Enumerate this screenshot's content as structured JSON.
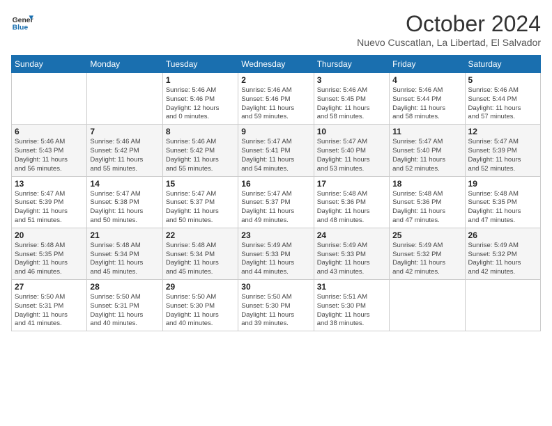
{
  "header": {
    "logo_general": "General",
    "logo_blue": "Blue",
    "month_title": "October 2024",
    "location": "Nuevo Cuscatlan, La Libertad, El Salvador"
  },
  "calendar": {
    "days_of_week": [
      "Sunday",
      "Monday",
      "Tuesday",
      "Wednesday",
      "Thursday",
      "Friday",
      "Saturday"
    ],
    "weeks": [
      [
        {
          "day": "",
          "info": ""
        },
        {
          "day": "",
          "info": ""
        },
        {
          "day": "1",
          "info": "Sunrise: 5:46 AM\nSunset: 5:46 PM\nDaylight: 12 hours\nand 0 minutes."
        },
        {
          "day": "2",
          "info": "Sunrise: 5:46 AM\nSunset: 5:46 PM\nDaylight: 11 hours\nand 59 minutes."
        },
        {
          "day": "3",
          "info": "Sunrise: 5:46 AM\nSunset: 5:45 PM\nDaylight: 11 hours\nand 58 minutes."
        },
        {
          "day": "4",
          "info": "Sunrise: 5:46 AM\nSunset: 5:44 PM\nDaylight: 11 hours\nand 58 minutes."
        },
        {
          "day": "5",
          "info": "Sunrise: 5:46 AM\nSunset: 5:44 PM\nDaylight: 11 hours\nand 57 minutes."
        }
      ],
      [
        {
          "day": "6",
          "info": "Sunrise: 5:46 AM\nSunset: 5:43 PM\nDaylight: 11 hours\nand 56 minutes."
        },
        {
          "day": "7",
          "info": "Sunrise: 5:46 AM\nSunset: 5:42 PM\nDaylight: 11 hours\nand 55 minutes."
        },
        {
          "day": "8",
          "info": "Sunrise: 5:46 AM\nSunset: 5:42 PM\nDaylight: 11 hours\nand 55 minutes."
        },
        {
          "day": "9",
          "info": "Sunrise: 5:47 AM\nSunset: 5:41 PM\nDaylight: 11 hours\nand 54 minutes."
        },
        {
          "day": "10",
          "info": "Sunrise: 5:47 AM\nSunset: 5:40 PM\nDaylight: 11 hours\nand 53 minutes."
        },
        {
          "day": "11",
          "info": "Sunrise: 5:47 AM\nSunset: 5:40 PM\nDaylight: 11 hours\nand 52 minutes."
        },
        {
          "day": "12",
          "info": "Sunrise: 5:47 AM\nSunset: 5:39 PM\nDaylight: 11 hours\nand 52 minutes."
        }
      ],
      [
        {
          "day": "13",
          "info": "Sunrise: 5:47 AM\nSunset: 5:39 PM\nDaylight: 11 hours\nand 51 minutes."
        },
        {
          "day": "14",
          "info": "Sunrise: 5:47 AM\nSunset: 5:38 PM\nDaylight: 11 hours\nand 50 minutes."
        },
        {
          "day": "15",
          "info": "Sunrise: 5:47 AM\nSunset: 5:37 PM\nDaylight: 11 hours\nand 50 minutes."
        },
        {
          "day": "16",
          "info": "Sunrise: 5:47 AM\nSunset: 5:37 PM\nDaylight: 11 hours\nand 49 minutes."
        },
        {
          "day": "17",
          "info": "Sunrise: 5:48 AM\nSunset: 5:36 PM\nDaylight: 11 hours\nand 48 minutes."
        },
        {
          "day": "18",
          "info": "Sunrise: 5:48 AM\nSunset: 5:36 PM\nDaylight: 11 hours\nand 47 minutes."
        },
        {
          "day": "19",
          "info": "Sunrise: 5:48 AM\nSunset: 5:35 PM\nDaylight: 11 hours\nand 47 minutes."
        }
      ],
      [
        {
          "day": "20",
          "info": "Sunrise: 5:48 AM\nSunset: 5:35 PM\nDaylight: 11 hours\nand 46 minutes."
        },
        {
          "day": "21",
          "info": "Sunrise: 5:48 AM\nSunset: 5:34 PM\nDaylight: 11 hours\nand 45 minutes."
        },
        {
          "day": "22",
          "info": "Sunrise: 5:48 AM\nSunset: 5:34 PM\nDaylight: 11 hours\nand 45 minutes."
        },
        {
          "day": "23",
          "info": "Sunrise: 5:49 AM\nSunset: 5:33 PM\nDaylight: 11 hours\nand 44 minutes."
        },
        {
          "day": "24",
          "info": "Sunrise: 5:49 AM\nSunset: 5:33 PM\nDaylight: 11 hours\nand 43 minutes."
        },
        {
          "day": "25",
          "info": "Sunrise: 5:49 AM\nSunset: 5:32 PM\nDaylight: 11 hours\nand 42 minutes."
        },
        {
          "day": "26",
          "info": "Sunrise: 5:49 AM\nSunset: 5:32 PM\nDaylight: 11 hours\nand 42 minutes."
        }
      ],
      [
        {
          "day": "27",
          "info": "Sunrise: 5:50 AM\nSunset: 5:31 PM\nDaylight: 11 hours\nand 41 minutes."
        },
        {
          "day": "28",
          "info": "Sunrise: 5:50 AM\nSunset: 5:31 PM\nDaylight: 11 hours\nand 40 minutes."
        },
        {
          "day": "29",
          "info": "Sunrise: 5:50 AM\nSunset: 5:30 PM\nDaylight: 11 hours\nand 40 minutes."
        },
        {
          "day": "30",
          "info": "Sunrise: 5:50 AM\nSunset: 5:30 PM\nDaylight: 11 hours\nand 39 minutes."
        },
        {
          "day": "31",
          "info": "Sunrise: 5:51 AM\nSunset: 5:30 PM\nDaylight: 11 hours\nand 38 minutes."
        },
        {
          "day": "",
          "info": ""
        },
        {
          "day": "",
          "info": ""
        }
      ]
    ]
  }
}
